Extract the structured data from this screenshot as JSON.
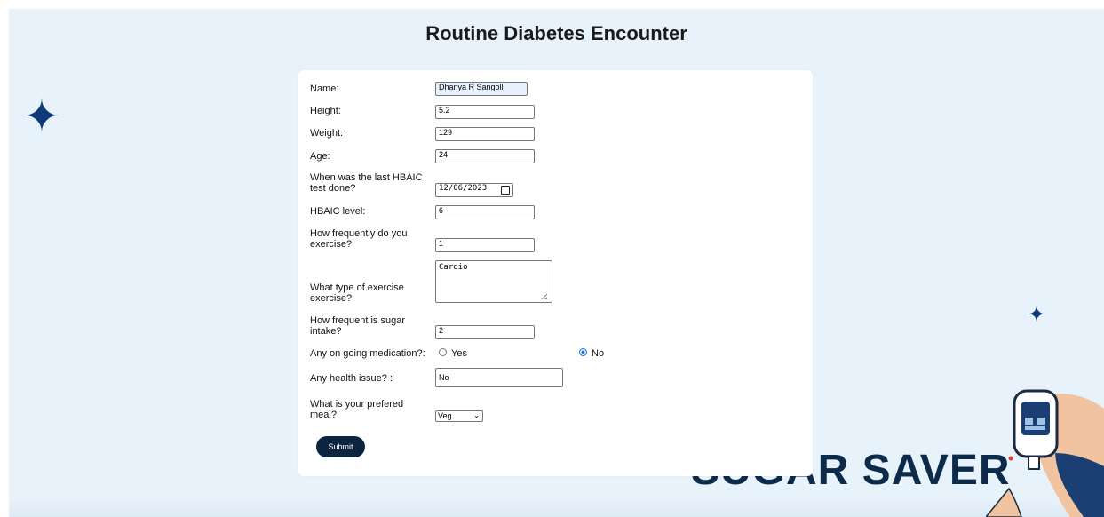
{
  "title": "Routine Diabetes Encounter",
  "brand": "SUGAR SAVER",
  "colors": {
    "accent": "#0c2440",
    "background": "#e8f2fb",
    "star": "#0e3a78"
  },
  "icons": {
    "left_star": "sparkle-icon",
    "right_star": "sparkle-icon",
    "date_picker": "calendar-icon",
    "select": "chevron-down-icon"
  },
  "form": {
    "name": {
      "label": "Name:",
      "value": "Dhanya R Sangolli"
    },
    "height": {
      "label": "Height:",
      "value": "5.2"
    },
    "weight": {
      "label": "Weight:",
      "value": "129"
    },
    "age": {
      "label": "Age:",
      "value": "24"
    },
    "last_hbaic": {
      "label_line1": "When was the last HBAIC",
      "label_line2": "test done?",
      "value": "12/06/2023"
    },
    "hbaic_level": {
      "label": "HBAIC level:",
      "value": "6"
    },
    "exercise_freq": {
      "label_line1": "How frequently do you",
      "label_line2": "exercise?",
      "value": "1"
    },
    "exercise_type": {
      "label_line1": "What type of exercise",
      "label_line2": "exercise?",
      "value": "Cardio"
    },
    "sugar_intake": {
      "label_line1": "How frequent is sugar",
      "label_line2": "intake?",
      "value": "2"
    },
    "medication": {
      "label": "Any on going medication?:",
      "yes_label": "Yes",
      "no_label": "No",
      "selected": "No"
    },
    "health_issue": {
      "label": "Any health issue? :",
      "value": "No"
    },
    "meal": {
      "label_line1": "What is your prefered",
      "label_line2": "meal?",
      "value": "Veg"
    },
    "submit_label": "Submit"
  }
}
